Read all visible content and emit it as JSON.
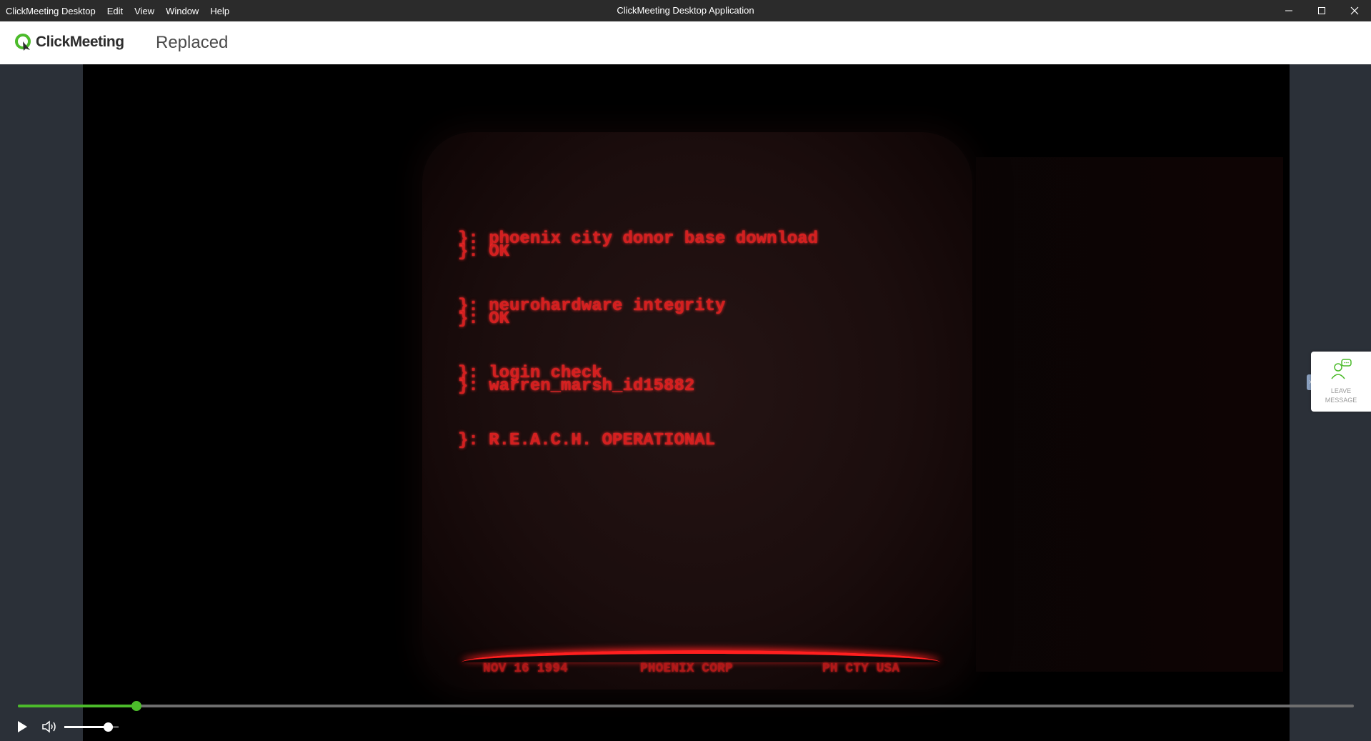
{
  "titlebar": {
    "menu": [
      "ClickMeeting Desktop",
      "Edit",
      "View",
      "Window",
      "Help"
    ],
    "title": "ClickMeeting Desktop Application"
  },
  "header": {
    "brand": "ClickMeeting",
    "page_title": "Replaced"
  },
  "video": {
    "terminal_lines": [
      [
        "}: phoenix city donor base download",
        "}: OK"
      ],
      [
        "}: neurohardware integrity",
        "}: OK"
      ],
      [
        "}: login check",
        "}: warren_marsh_id15882"
      ],
      [
        "}: R.E.A.C.H. OPERATIONAL"
      ]
    ],
    "footer": [
      "NOV 16 1994",
      "PHOENIX CORP",
      "PH CTY USA"
    ]
  },
  "leave_message": {
    "line1": "LEAVE",
    "line2": "MESSAGE"
  },
  "player": {
    "progress": 0.089,
    "volume": 0.8
  },
  "colors": {
    "accent": "#4cbb2b",
    "terminal_red": "#d41f1f"
  }
}
